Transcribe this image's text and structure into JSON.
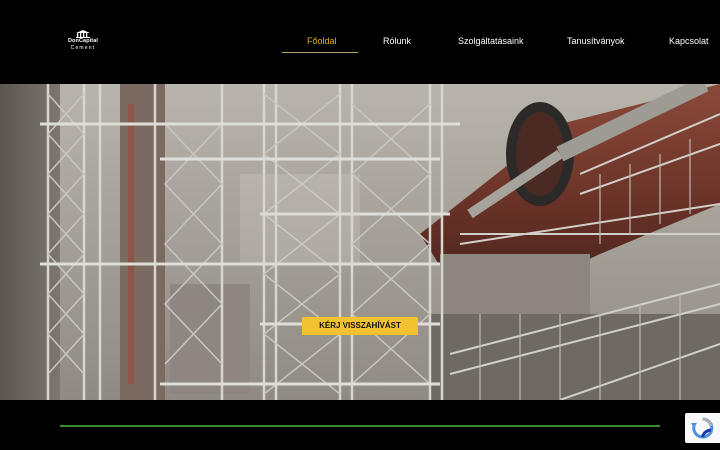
{
  "logo": {
    "line1": "DonCapital",
    "line2": "Cement",
    "icon": "building-icon"
  },
  "nav": {
    "items": [
      {
        "label": "Főoldal",
        "active": true
      },
      {
        "label": "Rólunk",
        "active": false
      },
      {
        "label": "Szolgáltatásaink",
        "active": false
      },
      {
        "label": "Tanusítványok",
        "active": false
      },
      {
        "label": "Kapcsolat",
        "active": false
      }
    ]
  },
  "hero": {
    "cta_label": "KÉRJ VISSZAHÍVÁST",
    "image": "cement-plant-kiln-photo"
  },
  "colors": {
    "accent": "#e6b422",
    "cta": "#f2c230",
    "footer_line": "#3c8b34",
    "background": "#000000"
  },
  "recaptcha": {
    "icon": "recaptcha-icon"
  }
}
